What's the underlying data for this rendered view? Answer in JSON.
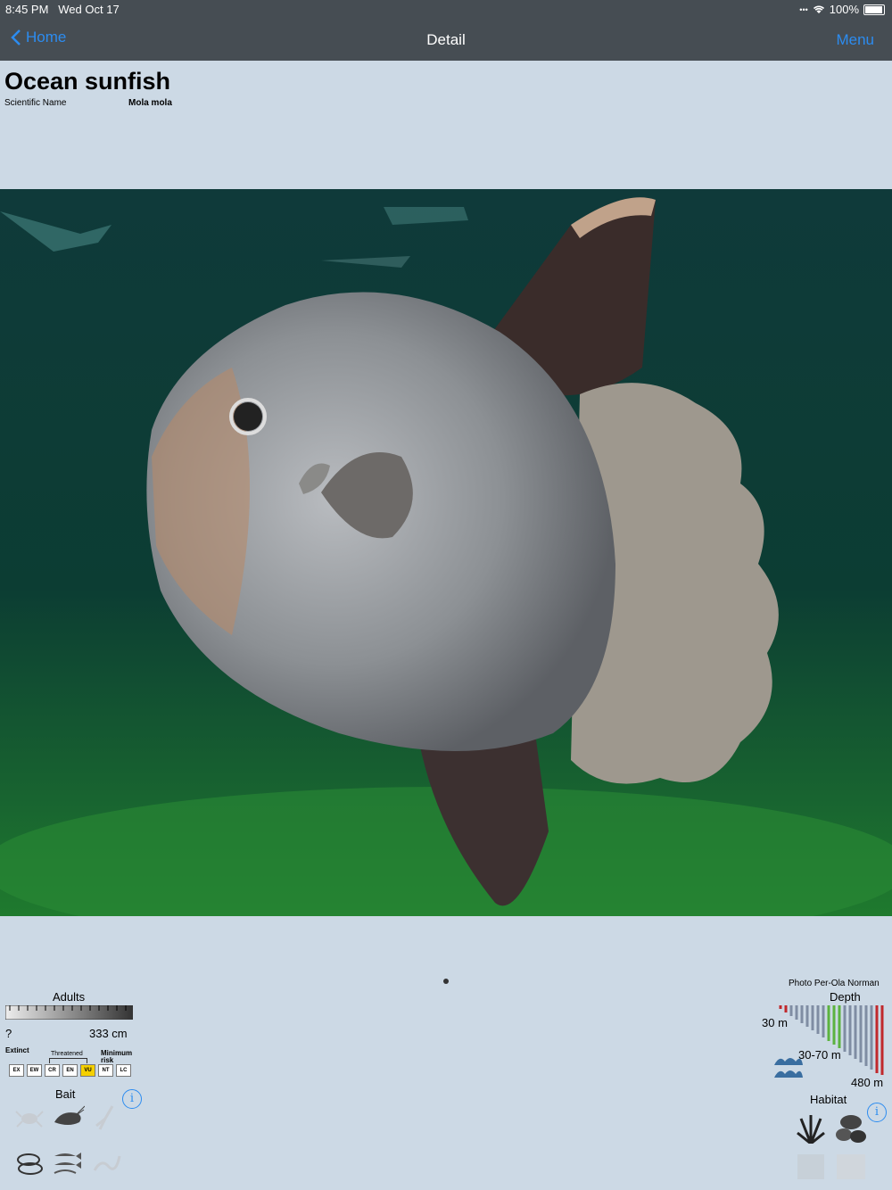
{
  "status": {
    "time": "8:45 PM",
    "date": "Wed Oct 17",
    "battery": "100%"
  },
  "nav": {
    "back_label": "Home",
    "title": "Detail",
    "menu_label": "Menu"
  },
  "species": {
    "common_name": "Ocean sunfish",
    "scientific_label": "Scientific Name",
    "scientific_name": "Mola mola"
  },
  "photo": {
    "credit": "Photo Per-Ola Norman"
  },
  "adults": {
    "heading": "Adults",
    "min": "?",
    "max": "333 cm"
  },
  "iucn": {
    "extinct": "Extinct",
    "threatened": "Threatened",
    "minimum_risk": "Minimum risk",
    "codes": [
      "EX",
      "EW",
      "CR",
      "EN",
      "VU",
      "NT",
      "LC"
    ],
    "selected": "VU"
  },
  "bait": {
    "heading": "Bait",
    "info": "i"
  },
  "depth": {
    "heading": "Depth",
    "top": "30 m",
    "range": "30-70 m",
    "bottom": "480 m"
  },
  "habitat": {
    "heading": "Habitat",
    "info": "i"
  },
  "colors": {
    "navbar": "#464d53",
    "link": "#2c8cf0",
    "background": "#ccd9e5",
    "iucn_selected": "#f5d000"
  }
}
